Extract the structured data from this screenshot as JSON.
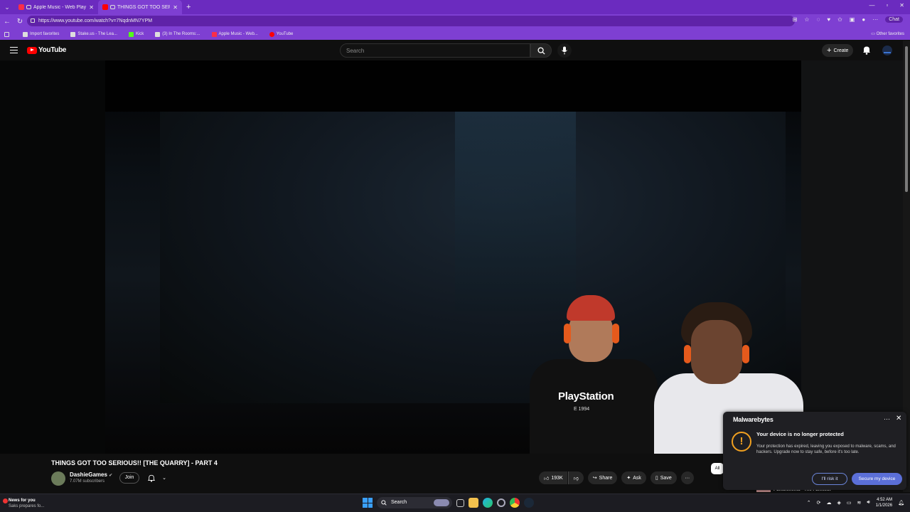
{
  "browser": {
    "tabs": [
      {
        "title": "Apple Music - Web Player",
        "active": false,
        "favicon_color": "#fa2d48"
      },
      {
        "title": "THINGS GOT TOO SERIOUS!! [",
        "active": true,
        "favicon_color": "#ff0000"
      }
    ],
    "url": "https://www.youtube.com/watch?v=7NqdnMN7YPM",
    "chat_label": "Chat",
    "bookmarks": [
      {
        "label": "Import favorites",
        "color": "#dddddd"
      },
      {
        "label": "Stake.us - The Lea...",
        "color": "#dddddd"
      },
      {
        "label": "Kick",
        "color": "#53fc18"
      },
      {
        "label": "(3) In The Rooms:...",
        "color": "#dddddd"
      },
      {
        "label": "Apple Music - Web...",
        "color": "#fa2d48"
      },
      {
        "label": "YouTube",
        "color": "#ff0000"
      }
    ],
    "other_favorites": "Other favorites"
  },
  "youtube": {
    "logo": "YouTube",
    "search_placeholder": "Search",
    "create_label": "Create",
    "video": {
      "title": "THINGS GOT TOO SERIOUS!! [THE QUARRY] - PART 4",
      "shirt_text": "PlayStation",
      "shirt_year": "E 1994"
    },
    "channel": {
      "name": "DashieGames",
      "subscribers": "7.07M subscribers",
      "join_label": "Join"
    },
    "actions": {
      "likes": "193K",
      "share": "Share",
      "ask": "Ask",
      "save": "Save"
    },
    "chip_all": "All",
    "next_video_title": "Punishments - The Funniest"
  },
  "popup": {
    "brand": "Malwarebytes",
    "heading": "Your device is no longer protected",
    "body": "Your protection has expired, leaving you exposed to malware, scams, and hackers. Upgrade now to stay safe, before it's too late.",
    "risk_label": "I'll risk it",
    "secure_label": "Secure my device",
    "accent": "#5b6fd8"
  },
  "taskbar": {
    "news_title": "News for you",
    "news_sub": "Saks prepares fo...",
    "search_label": "Search",
    "time": "4:52 AM",
    "date": "1/1/2026"
  }
}
